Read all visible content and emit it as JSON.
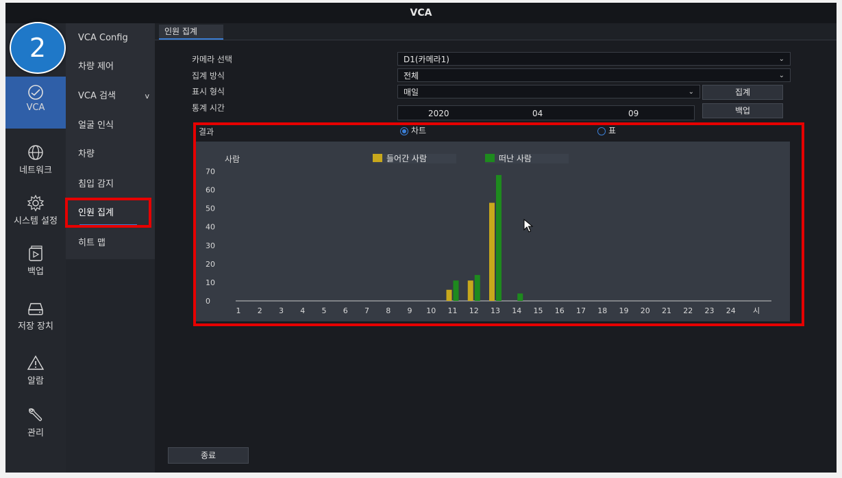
{
  "window": {
    "title": "VCA"
  },
  "step_badge": "2",
  "leftnav": {
    "items": [
      {
        "label": "VCA",
        "icon": "vca-icon"
      },
      {
        "label": "네트워크",
        "icon": "network-globe-icon"
      },
      {
        "label": "시스템 설정",
        "icon": "gear-icon"
      },
      {
        "label": "백업",
        "icon": "backup-icon"
      },
      {
        "label": "저장 장치",
        "icon": "storage-drive-icon"
      },
      {
        "label": "알람",
        "icon": "alarm-warning-icon"
      },
      {
        "label": "관리",
        "icon": "wrench-icon"
      }
    ]
  },
  "submenu": {
    "items": [
      {
        "label": "VCA Config"
      },
      {
        "label": "차량 제어"
      },
      {
        "label": "VCA 검색",
        "chevron": "v"
      },
      {
        "label": "얼굴 인식"
      },
      {
        "label": "차량"
      },
      {
        "label": "침입 감지"
      },
      {
        "label": "인원 집계"
      },
      {
        "label": "히트 맵"
      }
    ]
  },
  "tabs": [
    {
      "label": "인원 집계"
    }
  ],
  "form": {
    "camera": {
      "label": "카메라 선택",
      "value": "D1(카메라1)"
    },
    "method": {
      "label": "집계 방식",
      "value": "전체"
    },
    "display": {
      "label": "표시 형식",
      "value": "매일"
    },
    "time": {
      "label": "통계 시간",
      "year": "2020",
      "month": "04",
      "day": "09"
    },
    "count_button": "집계",
    "backup_button": "백업"
  },
  "result": {
    "label": "결과",
    "chart_option": "차트",
    "table_option": "표"
  },
  "chart_data": {
    "type": "bar",
    "ylabel": "사람",
    "xlabel": "시",
    "yticks": [
      0,
      10,
      20,
      30,
      40,
      50,
      60,
      70
    ],
    "ylim": [
      0,
      75
    ],
    "categories": [
      "1",
      "2",
      "3",
      "4",
      "5",
      "6",
      "7",
      "8",
      "9",
      "10",
      "11",
      "12",
      "13",
      "14",
      "15",
      "16",
      "17",
      "18",
      "19",
      "20",
      "21",
      "22",
      "23",
      "24"
    ],
    "series": [
      {
        "name": "들어간 사람",
        "color": "#c8a81c",
        "values": [
          0,
          0,
          0,
          0,
          0,
          0,
          0,
          0,
          0,
          0,
          6,
          11,
          53,
          0,
          0,
          0,
          0,
          0,
          0,
          0,
          0,
          0,
          0,
          0
        ]
      },
      {
        "name": "떠난 사람",
        "color": "#1e8a1e",
        "values": [
          0,
          0,
          0,
          0,
          0,
          0,
          0,
          0,
          0,
          0,
          11,
          14,
          68,
          4,
          0,
          0,
          0,
          0,
          0,
          0,
          0,
          0,
          0,
          0
        ]
      }
    ],
    "grid": false,
    "legend": "top-center"
  },
  "footer": {
    "exit_button": "종료"
  }
}
